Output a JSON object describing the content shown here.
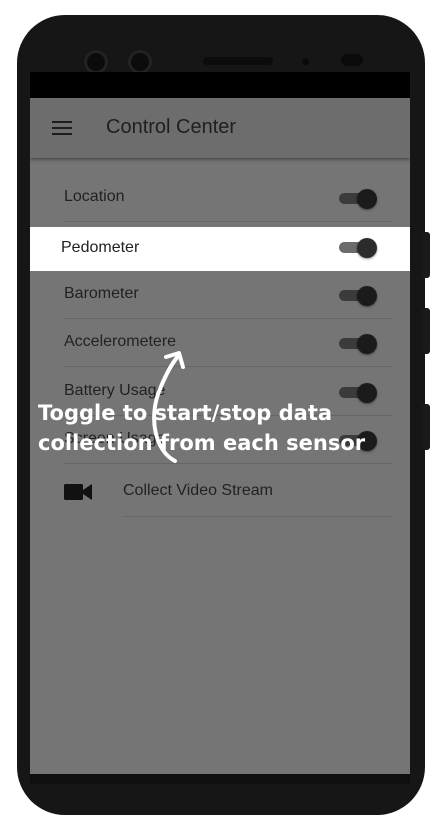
{
  "app": {
    "title": "Control Center"
  },
  "toggles": [
    {
      "label": "Location",
      "on": true
    },
    {
      "label": "Pedometer",
      "on": true
    },
    {
      "label": "Barometer",
      "on": true
    },
    {
      "label": "Accelerometere",
      "on": true
    },
    {
      "label": "Battery Usage",
      "on": true
    },
    {
      "label": "Screen Usage",
      "on": true
    }
  ],
  "video": {
    "label": "Collect Video Stream",
    "icon": "video-camera-icon"
  },
  "overlay": {
    "line1": "Toggle to start/stop data",
    "line2": "collection from each sensor"
  },
  "colors": {
    "screen_dim": "#757575",
    "highlight": "#ffffff",
    "overlay_text": "#ffffff"
  }
}
